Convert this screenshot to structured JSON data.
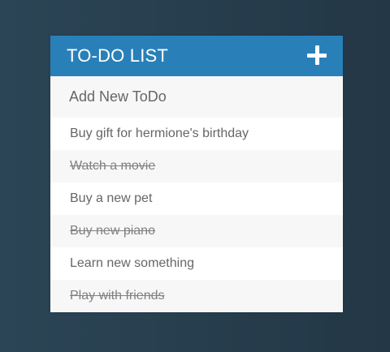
{
  "header": {
    "title": "TO-DO LIST",
    "add_icon": "plus-icon"
  },
  "new_todo": {
    "placeholder": "Add New ToDo",
    "value": ""
  },
  "todos": [
    {
      "text": "Buy gift for hermione's birthday",
      "done": false
    },
    {
      "text": "Watch a movie",
      "done": true
    },
    {
      "text": "Buy a new pet",
      "done": false
    },
    {
      "text": "Buy new piano",
      "done": true
    },
    {
      "text": "Learn new something",
      "done": false
    },
    {
      "text": "Play with friends",
      "done": true
    }
  ],
  "colors": {
    "header_bg": "#2980b9",
    "text": "#666666",
    "alt_row": "#f7f7f7"
  }
}
